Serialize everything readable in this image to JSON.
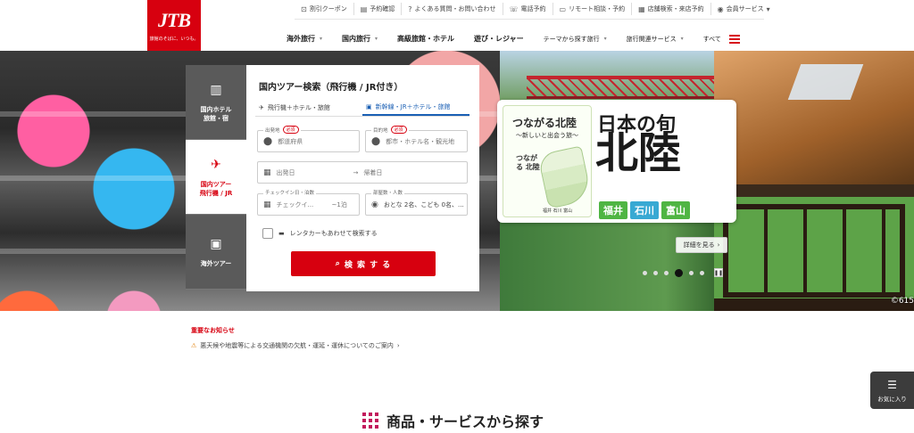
{
  "logo": {
    "mark": "JTB",
    "tagline": "旅館のそばに、いつも。"
  },
  "utility": [
    {
      "icon": "coupon-icon",
      "glyph": "⊡",
      "label": "割引クーポン"
    },
    {
      "icon": "booking-icon",
      "glyph": "▤",
      "label": "予約確認"
    },
    {
      "icon": "question-icon",
      "glyph": "?",
      "label": "よくある質問・お問い合わせ"
    },
    {
      "icon": "phone-icon",
      "glyph": "☏",
      "label": "電話予約"
    },
    {
      "icon": "monitor-icon",
      "glyph": "▭",
      "label": "リモート相談・予約"
    },
    {
      "icon": "store-icon",
      "glyph": "▦",
      "label": "店舗検索・来店予約"
    },
    {
      "icon": "user-icon",
      "glyph": "◉",
      "label": "会員サービス"
    }
  ],
  "nav": [
    {
      "label": "海外旅行"
    },
    {
      "label": "国内旅行"
    },
    {
      "label": "高級旅館・ホテル"
    },
    {
      "label": "遊び・レジャー"
    },
    {
      "label": "テーマから探す旅行"
    },
    {
      "label": "旅行関連サービス"
    },
    {
      "label": "すべて"
    }
  ],
  "side_tabs": [
    {
      "icon": "building-icon",
      "glyph": "▥",
      "label": "国内ホテル\n旅館・宿"
    },
    {
      "icon": "plane-train-icon",
      "glyph": "✈",
      "label": "国内ツアー\n飛行機 / JR"
    },
    {
      "icon": "suitcase-icon",
      "glyph": "▣",
      "label": "海外ツアー"
    }
  ],
  "search": {
    "title": "国内ツアー検索（飛行機 / JR付き）",
    "tab_air": "飛行機＋ホテル・旅館",
    "tab_rail": "新幹線・JR＋ホテル・旅館",
    "origin_label": "出発地",
    "origin_placeholder": "都道府県",
    "dest_label": "目的地",
    "dest_placeholder": "都市・ホテル名・観光地",
    "required": "必須",
    "depart_placeholder": "出発日",
    "arrow": "→",
    "return_placeholder": "帰着日",
    "checkin_label": "チェックイン日・泊数",
    "checkin_placeholder": "チェックイ...",
    "nights": "~1泊",
    "rooms_label": "部屋数・人数",
    "rooms_value": "おとな 2名、こども 0名、...",
    "rental_label": "レンタカーもあわせて検索する",
    "button": "検 索 す る"
  },
  "promo": {
    "tile_title": "つながる北陸",
    "tile_sub": "〜新しいと出会う旅〜",
    "map_title": "つながる 北陸",
    "map_foot": "福井 石川 富山",
    "headline": "日本の旬",
    "region": "北陸",
    "prefectures": [
      "福井",
      "石川",
      "富山"
    ],
    "detail": "詳細を見る",
    "credit": "©615"
  },
  "notice": {
    "title": "重要なお知らせ",
    "item": "悪天候や地震等による交通機関の欠航・運延・運休についてのご案内"
  },
  "section": {
    "title": "商品・サービスから探す"
  },
  "fav": {
    "label": "お気に入り"
  }
}
